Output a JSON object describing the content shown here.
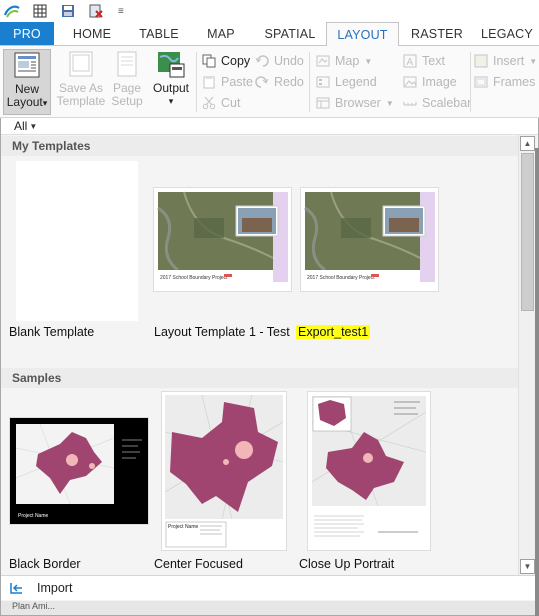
{
  "quick_access": {
    "icons": [
      "app-logo-icon",
      "grid-icon",
      "save-icon",
      "close-project-icon"
    ],
    "more_label": "‹ ≡"
  },
  "ribbon_tabs": [
    "PRO",
    "HOME",
    "TABLE",
    "MAP",
    "SPATIAL",
    "LAYOUT",
    "RASTER",
    "LEGACY"
  ],
  "active_tab": "LAYOUT",
  "ribbon": {
    "new_layout": {
      "line1": "New",
      "line2": "Layout",
      "arrow": "▾"
    },
    "save_as_template": {
      "line1": "Save As",
      "line2": "Template"
    },
    "page_setup": {
      "line1": "Page",
      "line2": "Setup"
    },
    "output": {
      "label": "Output",
      "arrow": "▾"
    },
    "copy": "Copy",
    "paste": "Paste",
    "cut": "Cut",
    "undo": "Undo",
    "redo": "Redo",
    "map": "Map",
    "legend": "Legend",
    "browser": "Browser",
    "text": "Text",
    "image": "Image",
    "scalebar": "Scalebar",
    "insert": "Insert",
    "frames": "Frames"
  },
  "gallery": {
    "filter_value": "All",
    "my_templates_heading": "My Templates",
    "samples_heading": "Samples",
    "my_templates": [
      {
        "name": "Blank Template"
      },
      {
        "name": "Layout Template 1  - Test",
        "footer_text": "2017 School Boundary Project"
      },
      {
        "name": "Export_test1",
        "footer_text": "2017 School Boundary Project",
        "highlighted": true
      }
    ],
    "samples": [
      {
        "name": "Black Border",
        "caption": "Project Name"
      },
      {
        "name": "Center Focused",
        "caption": "Project Name"
      },
      {
        "name": "Close Up Portrait"
      }
    ],
    "import_label": "Import",
    "partial_text": "Plan Ami..."
  },
  "colors": {
    "pro_blue": "#1a7fce",
    "active_tab_text": "#2a6fba",
    "highlight": "#ffff1a",
    "map_feature": "#a0456f",
    "map_feature_light": "#f2b6b8",
    "lavender": "#e4d1f0"
  }
}
